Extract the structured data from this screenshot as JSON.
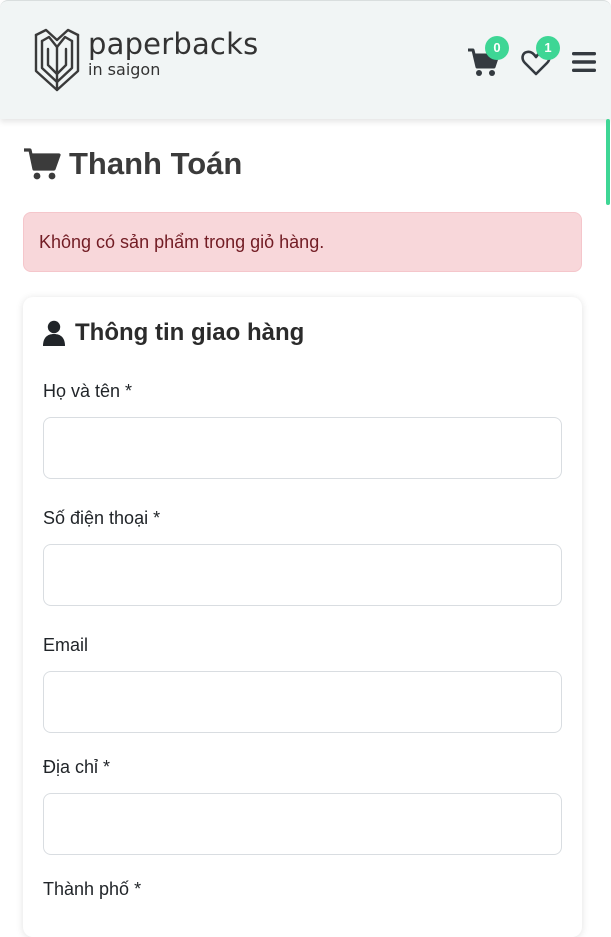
{
  "brand": {
    "name": "paperbacks",
    "sub": "in saigon"
  },
  "nav": {
    "cart_count": "0",
    "wishlist_count": "1",
    "badge_color": "#3ed695"
  },
  "page": {
    "title": "Thanh Toán"
  },
  "alert": {
    "message": "Không có sản phẩm trong giỏ hàng."
  },
  "shipping": {
    "heading": "Thông tin giao hàng",
    "fields": [
      {
        "label": "Họ và tên *",
        "value": "",
        "placeholder": ""
      },
      {
        "label": "Số điện thoại *",
        "value": "",
        "placeholder": ""
      },
      {
        "label": "Email",
        "value": "",
        "placeholder": ""
      },
      {
        "label": "Địa chỉ *",
        "value": "",
        "placeholder": ""
      },
      {
        "label": "Thành phố *",
        "value": "",
        "placeholder": ""
      }
    ]
  },
  "icons": [
    "book-logo-icon",
    "cart-icon",
    "heart-icon",
    "hamburger-menu-icon",
    "cart-title-icon",
    "user-icon"
  ]
}
